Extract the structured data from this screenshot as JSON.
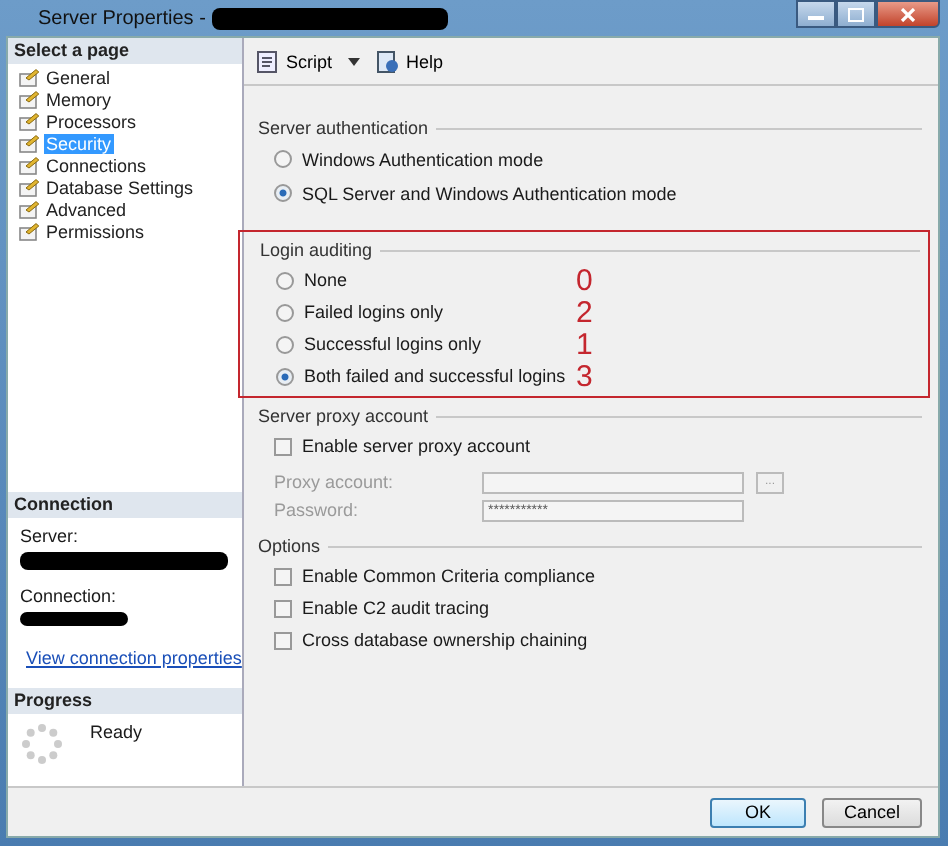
{
  "window": {
    "title": "Server Properties -"
  },
  "sidebar": {
    "header": "Select a page",
    "items": [
      {
        "label": "General",
        "selected": false
      },
      {
        "label": "Memory",
        "selected": false
      },
      {
        "label": "Processors",
        "selected": false
      },
      {
        "label": "Security",
        "selected": true
      },
      {
        "label": "Connections",
        "selected": false
      },
      {
        "label": "Database Settings",
        "selected": false
      },
      {
        "label": "Advanced",
        "selected": false
      },
      {
        "label": "Permissions",
        "selected": false
      }
    ]
  },
  "connection": {
    "header": "Connection",
    "server_label": "Server:",
    "connection_label": "Connection:",
    "link": "View connection properties"
  },
  "progress": {
    "header": "Progress",
    "status": "Ready"
  },
  "toolbar": [
    {
      "label": "Script",
      "kind": "dropdown"
    },
    {
      "label": "Help",
      "kind": "help"
    }
  ],
  "server_authentication": {
    "title": "Server authentication",
    "options": [
      {
        "label": "Windows Authentication mode",
        "selected": false
      },
      {
        "label": "SQL Server and Windows Authentication mode",
        "selected": true
      }
    ]
  },
  "login_auditing": {
    "title": "Login auditing",
    "options": [
      {
        "label": "None",
        "selected": false,
        "annotation": "0"
      },
      {
        "label": "Failed logins only",
        "selected": false,
        "annotation": "2"
      },
      {
        "label": "Successful logins only",
        "selected": false,
        "annotation": "1"
      },
      {
        "label": "Both failed and successful logins",
        "selected": true,
        "annotation": "3"
      }
    ]
  },
  "server_proxy": {
    "title": "Server proxy account",
    "enable": {
      "label": "Enable server proxy account",
      "checked": false
    },
    "fields": [
      {
        "label": "Proxy account:",
        "disabled": true,
        "browse": "..."
      },
      {
        "label": "Password:",
        "disabled": true,
        "value": "***********"
      }
    ]
  },
  "options": {
    "title": "Options",
    "items": [
      {
        "label": "Enable Common Criteria compliance",
        "checked": false
      },
      {
        "label": "Enable C2 audit tracing",
        "checked": false
      },
      {
        "label": "Cross database ownership chaining",
        "checked": false
      }
    ]
  },
  "buttons": [
    {
      "label": "OK",
      "default": true
    },
    {
      "label": "Cancel",
      "default": false
    }
  ]
}
